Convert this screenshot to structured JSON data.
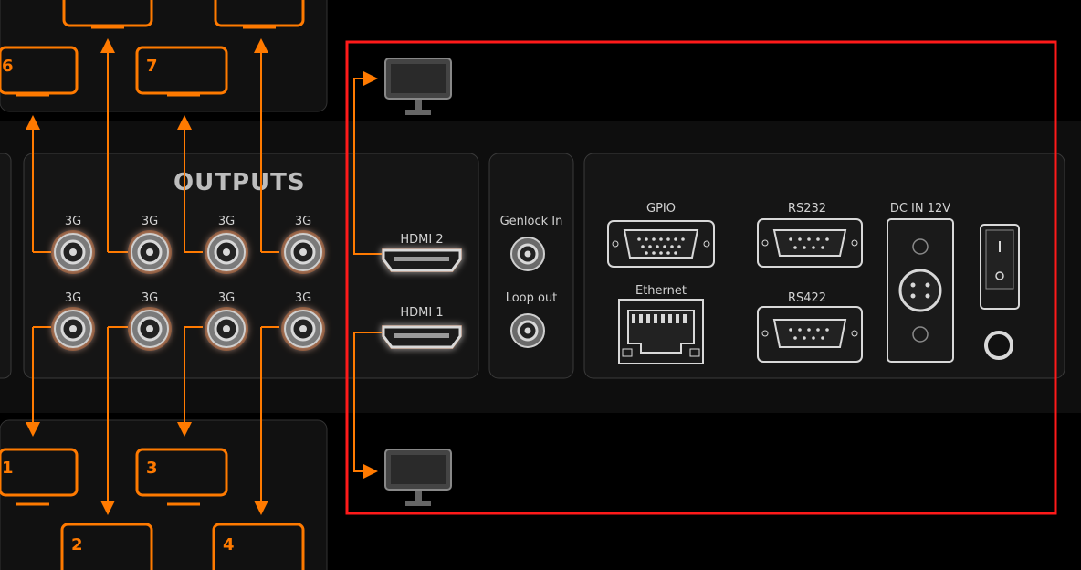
{
  "outputs_title": "OUTPUTS",
  "sdi_labels": [
    "3G",
    "3G",
    "3G",
    "3G",
    "3G",
    "3G",
    "3G",
    "3G"
  ],
  "hdmi": {
    "top": "HDMI 2",
    "bottom": "HDMI 1"
  },
  "genlock": {
    "in": "Genlock In",
    "loop": "Loop out"
  },
  "ports": {
    "gpio": "GPIO",
    "ethernet": "Ethernet",
    "rs232": "RS232",
    "rs422": "RS422",
    "dc": "DC IN 12V"
  },
  "monitor_numbers": {
    "top_left": "6",
    "top": "7",
    "bottom_left": "1",
    "bottom_mid": "3",
    "bottom_2": "2",
    "bottom_4": "4"
  },
  "colors": {
    "accent": "#ff7a00",
    "panel": "#141414",
    "highlight": "#ff1a1a",
    "monitor_gray": "#444444"
  }
}
